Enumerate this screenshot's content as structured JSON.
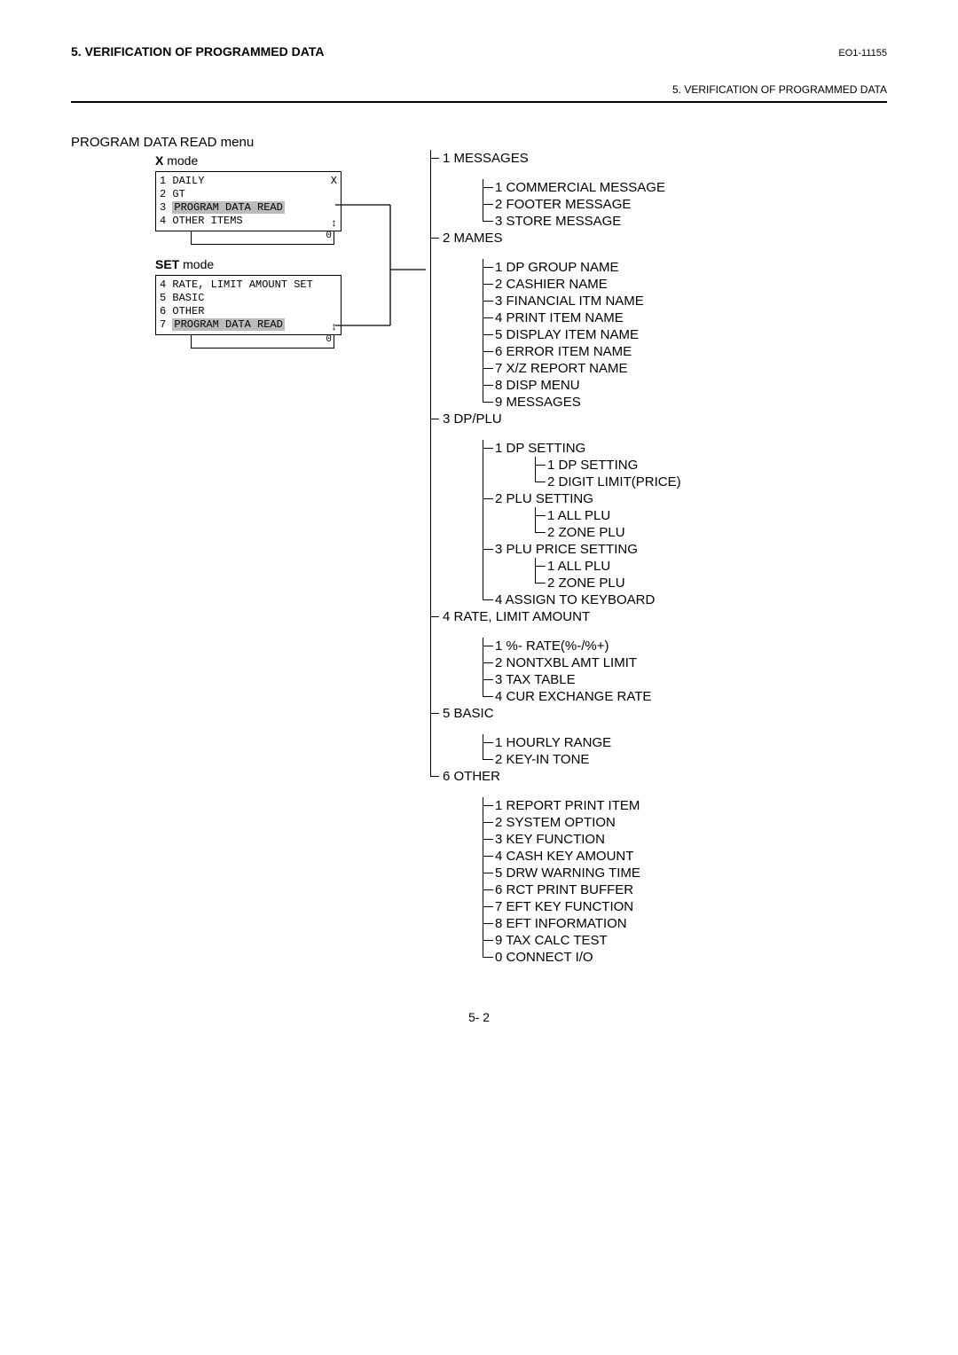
{
  "header": {
    "title": "5. VERIFICATION OF PROGRAMMED DATA",
    "code": "EO1-11155",
    "runner": "5. VERIFICATION OF PROGRAMMED DATA"
  },
  "section_title": "PROGRAM DATA READ menu",
  "x_mode": {
    "label": "X mode",
    "rows": [
      {
        "left": "1 DAILY",
        "right": "X"
      },
      {
        "left": "2 GT",
        "right": ""
      },
      {
        "left": "3 PROGRAM DATA READ",
        "right": "",
        "hl": true
      },
      {
        "left": "4 OTHER ITEMS",
        "right": ""
      }
    ],
    "scroll_zero": "0"
  },
  "set_mode": {
    "label": "SET mode",
    "rows": [
      {
        "left": "4 RATE, LIMIT AMOUNT SET",
        "right": ""
      },
      {
        "left": "5 BASIC",
        "right": ""
      },
      {
        "left": "6 OTHER",
        "right": ""
      },
      {
        "left": "7 PROGRAM DATA READ",
        "right": "",
        "hl": true
      }
    ],
    "scroll_zero": "0"
  },
  "tree": [
    {
      "n": "1",
      "t": "MESSAGES",
      "c": [
        {
          "n": "1",
          "t": "COMMERCIAL MESSAGE"
        },
        {
          "n": "2",
          "t": "FOOTER MESSAGE"
        },
        {
          "n": "3",
          "t": "STORE MESSAGE"
        }
      ]
    },
    {
      "n": "2",
      "t": "MAMES",
      "c": [
        {
          "n": "1",
          "t": "DP GROUP NAME"
        },
        {
          "n": "2",
          "t": "CASHIER NAME"
        },
        {
          "n": "3",
          "t": "FINANCIAL ITM NAME"
        },
        {
          "n": "4",
          "t": "PRINT ITEM NAME"
        },
        {
          "n": "5",
          "t": "DISPLAY ITEM NAME"
        },
        {
          "n": "6",
          "t": "ERROR ITEM NAME"
        },
        {
          "n": "7",
          "t": "X/Z REPORT NAME"
        },
        {
          "n": "8",
          "t": "DISP MENU"
        },
        {
          "n": "9",
          "t": "MESSAGES"
        }
      ]
    },
    {
      "n": "3",
      "t": "DP/PLU",
      "c": [
        {
          "n": "1",
          "t": "DP SETTING",
          "c": [
            {
              "n": "1",
              "t": "DP SETTING"
            },
            {
              "n": "2",
              "t": "DIGIT LIMIT(PRICE)"
            }
          ]
        },
        {
          "n": "2",
          "t": "PLU SETTING",
          "c": [
            {
              "n": "1",
              "t": "ALL PLU"
            },
            {
              "n": "2",
              "t": "ZONE PLU"
            }
          ]
        },
        {
          "n": "3",
          "t": "PLU PRICE SETTING",
          "c": [
            {
              "n": "1",
              "t": "ALL PLU"
            },
            {
              "n": "2",
              "t": "ZONE PLU"
            }
          ]
        },
        {
          "n": "4",
          "t": "ASSIGN TO KEYBOARD"
        }
      ]
    },
    {
      "n": "4",
      "t": "RATE, LIMIT AMOUNT",
      "c": [
        {
          "n": "1",
          "t": "%- RATE(%-/%+)"
        },
        {
          "n": "2",
          "t": "NONTXBL AMT LIMIT"
        },
        {
          "n": "3",
          "t": "TAX TABLE"
        },
        {
          "n": "4",
          "t": "CUR EXCHANGE RATE"
        }
      ]
    },
    {
      "n": "5",
      "t": "BASIC",
      "c": [
        {
          "n": "1",
          "t": "HOURLY RANGE"
        },
        {
          "n": "2",
          "t": "KEY-IN TONE"
        }
      ]
    },
    {
      "n": "6",
      "t": "OTHER",
      "c": [
        {
          "n": "1",
          "t": "REPORT PRINT ITEM"
        },
        {
          "n": "2",
          "t": "SYSTEM OPTION"
        },
        {
          "n": "3",
          "t": "KEY FUNCTION"
        },
        {
          "n": "4",
          "t": "CASH KEY AMOUNT"
        },
        {
          "n": "5",
          "t": "DRW WARNING TIME"
        },
        {
          "n": "6",
          "t": "RCT PRINT BUFFER"
        },
        {
          "n": "7",
          "t": "EFT KEY FUNCTION"
        },
        {
          "n": "8",
          "t": "EFT INFORMATION"
        },
        {
          "n": "9",
          "t": "TAX CALC TEST"
        },
        {
          "n": "0",
          "t": "CONNECT I/O"
        }
      ]
    }
  ],
  "page_num": "5- 2"
}
